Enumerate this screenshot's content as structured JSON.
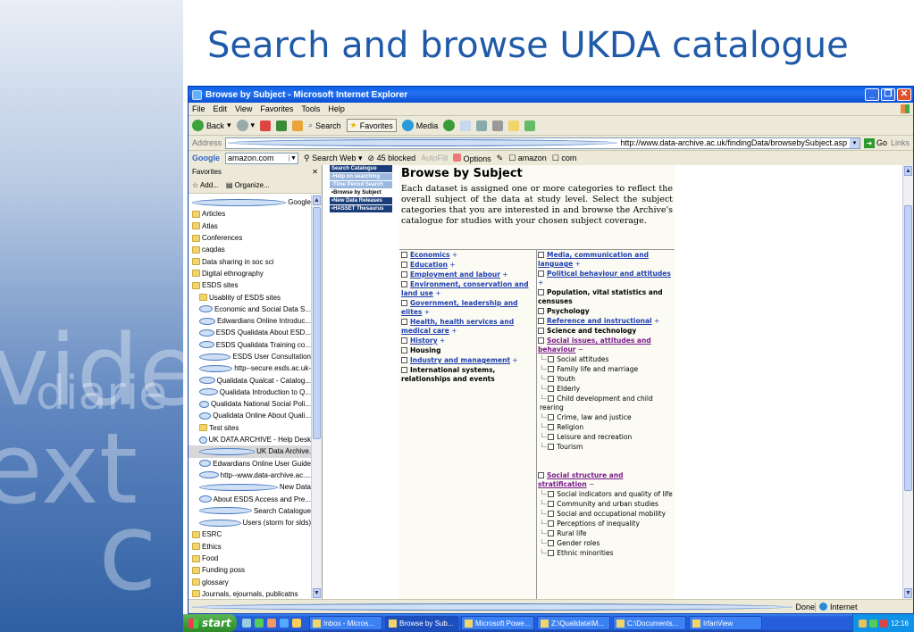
{
  "slide": {
    "title": "Search and browse UKDA catalogue",
    "watermark": [
      "vide",
      "diarie",
      "ext",
      "c"
    ]
  },
  "window": {
    "title": "Browse by Subject - Microsoft Internet Explorer"
  },
  "menu": [
    "File",
    "Edit",
    "View",
    "Favorites",
    "Tools",
    "Help"
  ],
  "toolbar": {
    "back": "Back",
    "search": "Search",
    "favorites": "Favorites",
    "media": "Media"
  },
  "address": {
    "label": "Address",
    "url": "http://www.data-archive.ac.uk/findingData/browsebySubject.asp",
    "go": "Go",
    "links": "Links"
  },
  "google": {
    "logo": "Google",
    "query": "amazon.com",
    "search_web": "Search Web",
    "blocked": "45 blocked",
    "autofill": "AutoFill",
    "options": "Options",
    "amazon": "amazon",
    "com": "com"
  },
  "favorites_pane": {
    "title": "Favorites",
    "add": "Add...",
    "organize": "Organize...",
    "items": [
      {
        "label": "Google",
        "type": "page",
        "level": 0
      },
      {
        "label": "Articles",
        "type": "folder",
        "level": 0
      },
      {
        "label": "Atlas",
        "type": "folder",
        "level": 0
      },
      {
        "label": "Conferences",
        "type": "folder",
        "level": 0
      },
      {
        "label": "caqdas",
        "type": "folder",
        "level": 0
      },
      {
        "label": "Data sharing in soc sci",
        "type": "folder",
        "level": 0
      },
      {
        "label": "Digital ethnography",
        "type": "folder",
        "level": 0
      },
      {
        "label": "ESDS sites",
        "type": "folder",
        "level": 0
      },
      {
        "label": "Usablity of ESDS sites",
        "type": "folder",
        "level": 1
      },
      {
        "label": "Economic and Social Data S...",
        "type": "page",
        "level": 1
      },
      {
        "label": "Edwardians Online  Introduc...",
        "type": "page",
        "level": 1
      },
      {
        "label": "ESDS Qualidata  About ESD...",
        "type": "page",
        "level": 1
      },
      {
        "label": "ESDS Qualidata  Training co...",
        "type": "page",
        "level": 1
      },
      {
        "label": "ESDS User Consultation",
        "type": "page",
        "level": 1
      },
      {
        "label": "http--secure.esds.ac.uk-",
        "type": "page",
        "level": 1
      },
      {
        "label": "Qualidata  Qualcat - Catalog...",
        "type": "page",
        "level": 1
      },
      {
        "label": "Qualidata  Introduction to Q...",
        "type": "page",
        "level": 1
      },
      {
        "label": "Qualidata  National Social Poli...",
        "type": "page",
        "level": 1
      },
      {
        "label": "Qualidata Online  About Quali...",
        "type": "page",
        "level": 1
      },
      {
        "label": "Test sites",
        "type": "folder",
        "level": 1
      },
      {
        "label": "UK DATA ARCHIVE - Help Desk",
        "type": "page",
        "level": 1
      },
      {
        "label": "UK Data Archive.",
        "type": "page",
        "level": 1,
        "selected": true
      },
      {
        "label": "Edwardians Online  User Guide",
        "type": "page",
        "level": 1
      },
      {
        "label": "http--www.data-archive.ac....",
        "type": "page",
        "level": 1
      },
      {
        "label": "New Data",
        "type": "page",
        "level": 1
      },
      {
        "label": "About ESDS Access and Pre...",
        "type": "page",
        "level": 1
      },
      {
        "label": "Search Catalogue",
        "type": "page",
        "level": 1
      },
      {
        "label": "Users (storm for slds)",
        "type": "page",
        "level": 1
      },
      {
        "label": "ESRC",
        "type": "folder",
        "level": 0
      },
      {
        "label": "Ethics",
        "type": "folder",
        "level": 0
      },
      {
        "label": "Food",
        "type": "folder",
        "level": 0
      },
      {
        "label": "Funding poss",
        "type": "folder",
        "level": 0
      },
      {
        "label": "glossary",
        "type": "folder",
        "level": 0
      },
      {
        "label": "Journals, ejournals, publicatns",
        "type": "folder",
        "level": 0
      }
    ]
  },
  "leftnav": {
    "items": [
      {
        "label": "Search Catalogue",
        "style": "dark"
      },
      {
        "label": "-Help on searching",
        "style": "light"
      },
      {
        "label": "-Time Period Search",
        "style": "light"
      },
      {
        "label": "•Browse by Subject",
        "style": "white"
      },
      {
        "label": "•New Data Releases",
        "style": "dark"
      },
      {
        "label": "•HASSET Thesaurus",
        "style": "dark"
      }
    ]
  },
  "browse": {
    "heading": "Browse by Subject",
    "intro": "Each dataset is assigned one or more categories to reflect the overall subject of the data at study level. Select the subject categories that you are interested in and browse the Archive's catalogue for studies with your chosen subject coverage.",
    "left_categories": [
      {
        "label": "Economics",
        "suffix": "+",
        "link": true
      },
      {
        "label": "Education",
        "suffix": "+",
        "link": true
      },
      {
        "label": "Employment and labour",
        "suffix": "+",
        "link": true
      },
      {
        "label": "Environment, conservation and land use",
        "suffix": "+",
        "link": true
      },
      {
        "label": "Government, leadership and elites",
        "suffix": "+",
        "link": true
      },
      {
        "label": "Health, health services and medical care",
        "suffix": "+",
        "link": true
      },
      {
        "label": "History",
        "suffix": "+",
        "link": true
      },
      {
        "label": "Housing",
        "suffix": "",
        "link": false
      },
      {
        "label": "Industry and management",
        "suffix": "+",
        "link": true
      },
      {
        "label": "International systems, relationships and events",
        "suffix": "",
        "link": false
      }
    ],
    "right_categories": [
      {
        "label": "Media, communication and language",
        "suffix": "+",
        "link": true
      },
      {
        "label": "Political behaviour and attitudes",
        "suffix": "+",
        "link": true
      },
      {
        "label": "Population, vital statistics and censuses",
        "suffix": "",
        "link": false
      },
      {
        "label": "Psychology",
        "suffix": "",
        "link": false
      },
      {
        "label": "Reference and instructional",
        "suffix": "+",
        "link": true
      },
      {
        "label": "Science and technology",
        "suffix": "",
        "link": false
      },
      {
        "label": "Social issues, attitudes and behaviour",
        "suffix": "−",
        "link": true,
        "visited": true
      },
      {
        "label": "Social attitudes",
        "sub": true
      },
      {
        "label": "Family life and marriage",
        "sub": true
      },
      {
        "label": "Youth",
        "sub": true
      },
      {
        "label": "Elderly",
        "sub": true
      },
      {
        "label": "Child development and child rearing",
        "sub": true
      },
      {
        "label": "Crime, law and justice",
        "sub": true
      },
      {
        "label": "Religion",
        "sub": true
      },
      {
        "label": "Leisure and recreation",
        "sub": true
      },
      {
        "label": "Tourism",
        "sub": true
      },
      {
        "label": "",
        "spacer": true
      },
      {
        "label": "Social structure and stratification",
        "suffix": "−",
        "link": true,
        "visited": true
      },
      {
        "label": "Social indicators and quality of life",
        "sub": true
      },
      {
        "label": "Community and urban studies",
        "sub": true
      },
      {
        "label": "Social and occupational mobility",
        "sub": true
      },
      {
        "label": "Perceptions of inequality",
        "sub": true
      },
      {
        "label": "Rural life",
        "sub": true
      },
      {
        "label": "Gender roles",
        "sub": true
      },
      {
        "label": "Ethnic minorities",
        "sub": true
      }
    ]
  },
  "status": {
    "text": "Done",
    "zone": "Internet"
  },
  "taskbar": {
    "start": "start",
    "tasks": [
      {
        "label": "Inbox - Micros..."
      },
      {
        "label": "Browse by Sub...",
        "active": true
      },
      {
        "label": "Microsoft Powe..."
      },
      {
        "label": "Z:\\Qualidata\\M..."
      },
      {
        "label": "C:\\Documents..."
      },
      {
        "label": "IrfanView"
      }
    ],
    "clock": "12:16"
  }
}
